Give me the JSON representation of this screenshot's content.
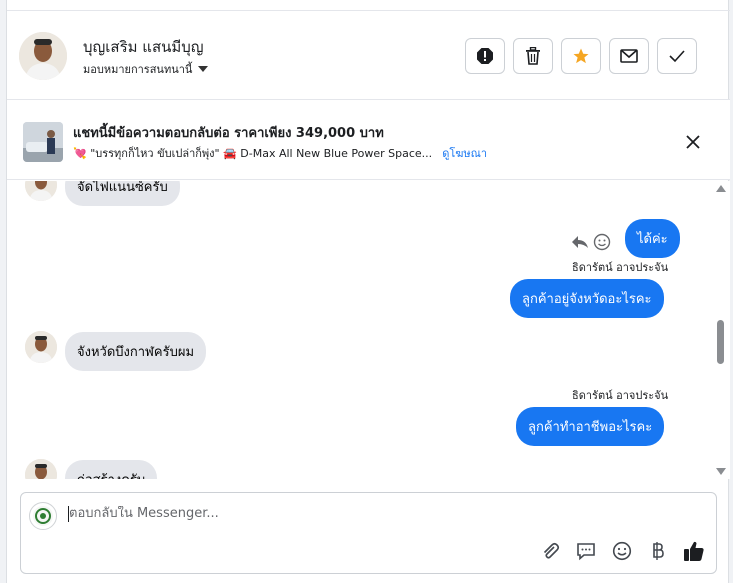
{
  "header": {
    "contact_name": "บุญเสริม แสนมีบุญ",
    "assign_label": "มอบหมายการสนทนานี้",
    "actions": [
      "spam-icon",
      "trash-icon",
      "star-icon",
      "mail-icon",
      "check-icon"
    ],
    "star_color": "#f5a623"
  },
  "ad": {
    "title": "แชทนี้มีข้อความตอบกลับต่อ ราคาเพียง 349,000 บาท",
    "subtitle": "💘 \"บรรทุกก็ไหว ขับเปล่าก็พุ่ง\" 🚘 D-Max All New Blue Power Space...",
    "link": "ดูโฆษณา"
  },
  "messages": [
    {
      "direction": "in",
      "text": "จัดไฟแนนซ์ครับ"
    },
    {
      "direction": "out",
      "text": "ได้ค่ะ"
    },
    {
      "direction": "out",
      "sender": "ธิดารัตน์ อาจประจัน",
      "text": "ลูกค้าอยู่จังหวัดอะไรคะ"
    },
    {
      "direction": "in",
      "text": "จังหวัดบึงกาฬครับผม"
    },
    {
      "direction": "out",
      "sender": "ธิดารัตน์ อาจประจัน",
      "text": "ลูกค้าทำอาชีพอะไรคะ"
    },
    {
      "direction": "in",
      "text": "ก่อสร้างครับ"
    }
  ],
  "composer": {
    "placeholder": "ตอบกลับใน Messenger...",
    "tools": [
      "attach-icon",
      "saved-reply-icon",
      "emoji-icon",
      "baht-icon",
      "thumbs-up-icon"
    ]
  },
  "colors": {
    "outgoing_bubble": "#1877f2",
    "incoming_bubble": "#e4e6eb",
    "link": "#1877f2"
  }
}
